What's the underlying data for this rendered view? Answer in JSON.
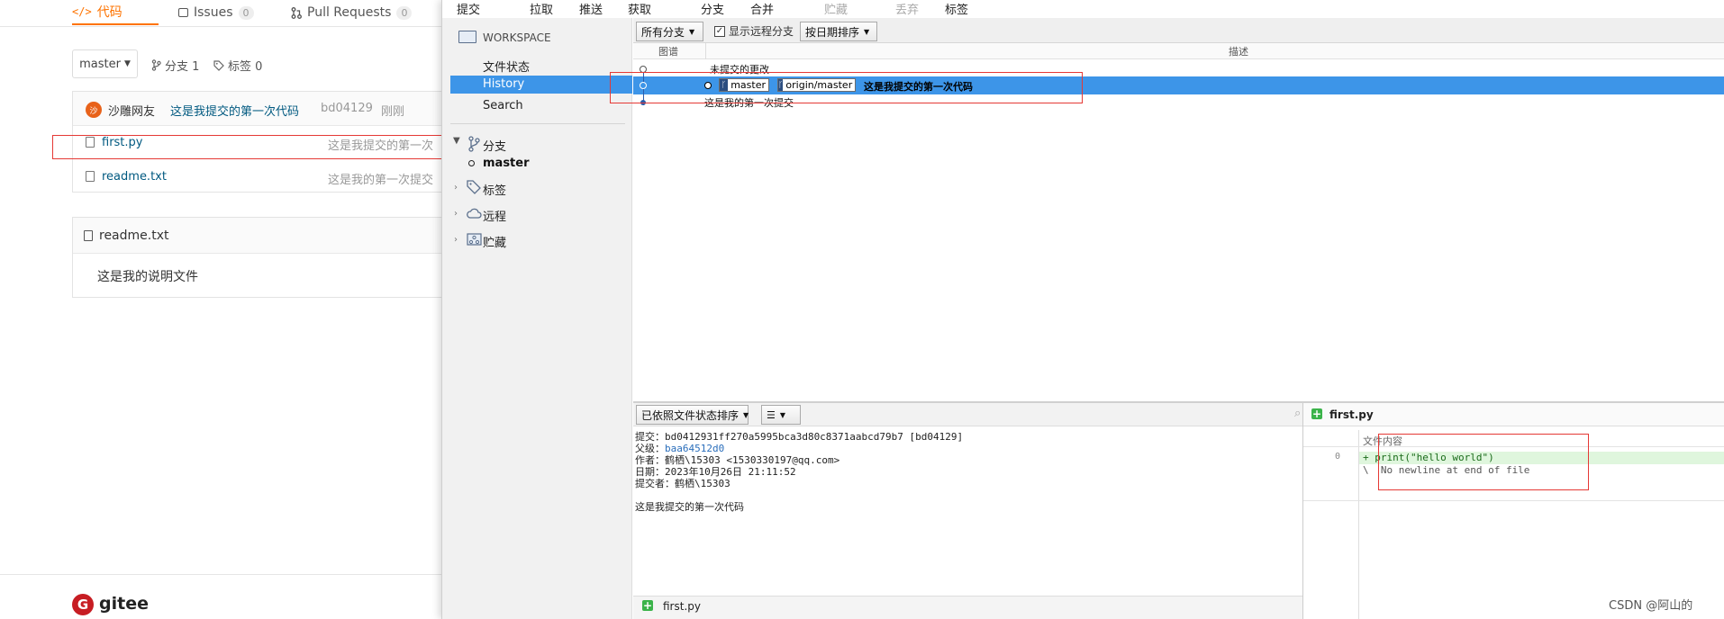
{
  "gitee": {
    "tabs": [
      {
        "label": "代码",
        "icon": "code-icon"
      },
      {
        "label": "Issues",
        "count": "0",
        "icon": "issue-icon"
      },
      {
        "label": "Pull Requests",
        "count": "0",
        "icon": "pull-request-icon"
      }
    ],
    "branch_select": "master",
    "branch_count": "分支 1",
    "tag_count": "标签 0",
    "commit": {
      "avatar_text": "沙",
      "author": "沙雕网友",
      "message": "这是我提交的第一次代码",
      "hash": "bd04129",
      "time": "刚刚"
    },
    "files": [
      {
        "name": "first.py",
        "msg": "这是我提交的第一次"
      },
      {
        "name": "readme.txt",
        "msg": "这是我的第一次提交"
      }
    ],
    "readme": {
      "title": "readme.txt",
      "content": "这是我的说明文件"
    },
    "logo_text": "gitee"
  },
  "sourcetree": {
    "toolbar": [
      "提交",
      "拉取",
      "推送",
      "获取",
      "分支",
      "合并",
      "贮藏",
      "丢弃",
      "标签"
    ],
    "toolbar_disabled": [
      false,
      false,
      false,
      false,
      false,
      false,
      true,
      true,
      false
    ],
    "sidebar": {
      "workspace": "WORKSPACE",
      "file_status": "文件状态",
      "history": "History",
      "search": "Search",
      "branches": "分支",
      "branch_master": "master",
      "tags": "标签",
      "remotes": "远程",
      "stashes": "贮藏"
    },
    "filter": {
      "all_branches": "所有分支",
      "show_remote": "显示远程分支",
      "sort": "按日期排序"
    },
    "columns": {
      "graph": "图谱",
      "description": "描述"
    },
    "commits": [
      {
        "text": "未提交的更改"
      },
      {
        "branch": "master",
        "remote": "origin/master",
        "text": "这是我提交的第一次代码"
      },
      {
        "text": "这是我的第一次提交"
      }
    ],
    "details": {
      "sort_label": "已依照文件状态排序",
      "commit_label": "提交：",
      "commit_value": "bd0412931ff270a5995bca3d80c8371aabcd79b7 [bd04129]",
      "parent_label": "父级：",
      "parent_value": "baa64512d0",
      "author_label": "作者：",
      "author_value": "鹤栖\\15303 <1530330197@qq.com>",
      "date_label": "日期：",
      "date_value": "2023年10月26日 21:11:52",
      "committer_label": "提交者：",
      "committer_value": "鹤栖\\15303",
      "message": "这是我提交的第一次代码"
    },
    "changed_file": "first.py",
    "diff": {
      "file": "first.py",
      "header": "文件内容",
      "line_no": "0",
      "line1": "+ print(\"hello world\")",
      "line2": "\\  No newline at end of file"
    }
  },
  "watermark": "CSDN @阿山的"
}
